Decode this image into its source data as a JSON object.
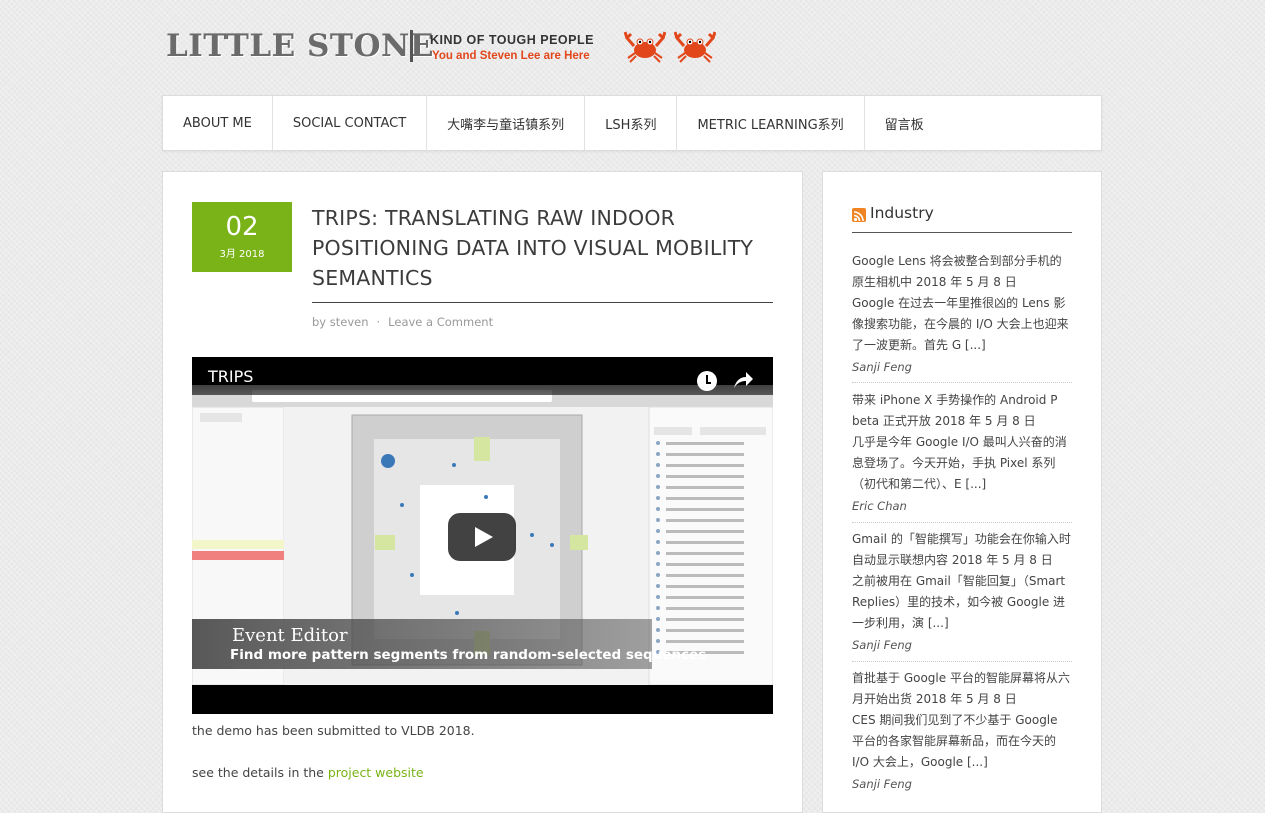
{
  "header": {
    "site_title": "LITTLE STONE",
    "tagline_top": "KIND OF TOUGH PEOPLE",
    "tagline_bottom": "You and Steven Lee are Here",
    "crab_color": "#e2471c"
  },
  "nav": {
    "items": [
      "ABOUT ME",
      "SOCIAL CONTACT",
      "大嘴李与童话镇系列",
      "LSH系列",
      "METRIC LEARNING系列",
      "留言板"
    ]
  },
  "post": {
    "day": "02",
    "month": "3月 2018",
    "title": "TRIPS: TRANSLATING RAW INDOOR POSITIONING DATA INTO VISUAL MOBILITY SEMANTICS",
    "author": "by steven",
    "comment_link": "Leave a Comment",
    "video": {
      "title": "TRIPS",
      "overlay_heading": "Event Editor",
      "overlay_caption": "Find more pattern segments from random-selected sequences",
      "play_icon": "play-icon",
      "clock_icon": "clock-icon",
      "share_icon": "share-icon"
    },
    "paragraph1": "the demo has been submitted to VLDB 2018.",
    "paragraph2_prefix": "see the details in the ",
    "paragraph2_link": "project website",
    "accent_color": "#7ab317"
  },
  "sidebar": {
    "widget_title": "Industry",
    "rss_icon": "rss-icon",
    "items": [
      {
        "head": "Google Lens 将会被整合到部分手机的原生相机中",
        "date": "2018 年 5 月 8 日",
        "body": "Google 在过去一年里推很凶的 Lens 影像搜索功能，在今晨的 I/O 大会上也迎来了一波更新。首先 G [...]",
        "author": "Sanji Feng"
      },
      {
        "head": "带来 iPhone X 手势操作的 Android P beta 正式开放",
        "date": "2018 年 5 月 8 日",
        "body": "几乎是今年 Google I/O 最叫人兴奋的消息登场了。今天开始，手执 Pixel 系列（初代和第二代）、E [...]",
        "author": "Eric Chan"
      },
      {
        "head": "Gmail 的「智能撰写」功能会在你输入时自动显示联想内容",
        "date": "2018 年 5 月 8 日",
        "body": "之前被用在 Gmail「智能回复」（Smart Replies）里的技术，如今被 Google 进一步利用，演 [...]",
        "author": "Sanji Feng"
      },
      {
        "head": "首批基于 Google 平台的智能屏幕将从六月开始出货",
        "date": "2018 年 5 月 8 日",
        "body": "CES 期间我们见到了不少基于 Google 平台的各家智能屏幕新品，而在今天的 I/O 大会上，Google [...]",
        "author": "Sanji Feng"
      }
    ]
  }
}
